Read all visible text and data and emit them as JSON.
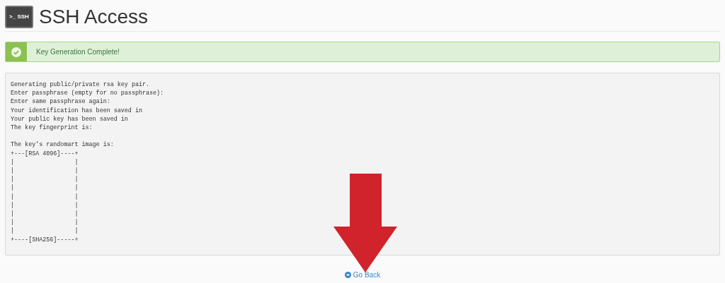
{
  "header": {
    "icon_label": ">_ SSH",
    "title": "SSH Access"
  },
  "alert": {
    "kind": "success",
    "message": "Key Generation Complete!"
  },
  "output": "Generating public/private rsa key pair.\nEnter passphrase (empty for no passphrase):\nEnter same passphrase again:\nYour identification has been saved in\nYour public key has been saved in\nThe key fingerprint is:\n\nThe key's randomart image is:\n+---[RSA 4096]----+\n|                 |\n|                 |\n|                 |\n|                 |\n|                 |\n|                 |\n|                 |\n|                 |\n|                 |\n+----[SHA256]-----+",
  "go_back": {
    "label": "Go Back"
  }
}
